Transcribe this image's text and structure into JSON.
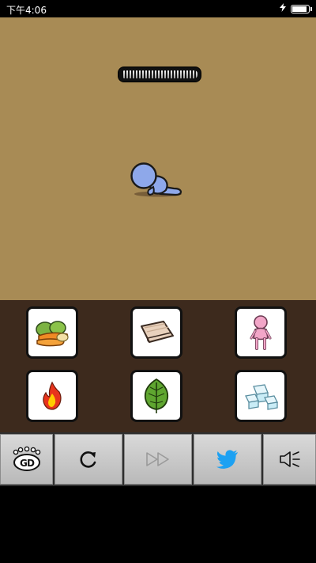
{
  "status_bar": {
    "time": "下午4:06",
    "charging_icon": "bolt-icon",
    "battery_level": 0.9
  },
  "scene": {
    "background_color": "#a88b55",
    "progress": 0.0,
    "character": "crawling-baby"
  },
  "items": [
    {
      "icon": "vegetables-icon"
    },
    {
      "icon": "cloth-icon"
    },
    {
      "icon": "doll-icon"
    },
    {
      "icon": "fire-icon"
    },
    {
      "icon": "leaf-icon"
    },
    {
      "icon": "ice-cubes-icon"
    }
  ],
  "toolbar": {
    "buttons": [
      {
        "icon": "gd-logo-icon"
      },
      {
        "icon": "restart-icon"
      },
      {
        "icon": "fast-forward-icon",
        "disabled": true
      },
      {
        "icon": "twitter-bird-icon",
        "color": "#1da1f2"
      },
      {
        "icon": "speaker-icon"
      }
    ]
  }
}
